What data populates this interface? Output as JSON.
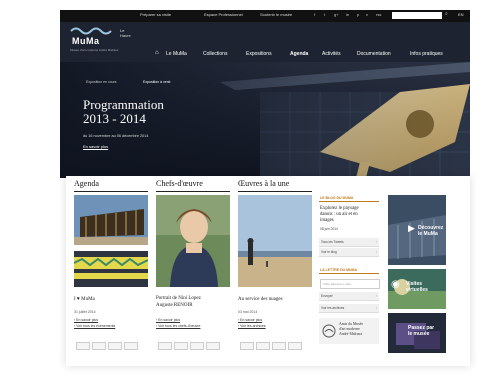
{
  "topbar": {
    "links": [
      "Préparer sa visite",
      "Espace Professionnel",
      "Soutenir le musée"
    ],
    "social": [
      "f",
      "t",
      "g+",
      "in",
      "p",
      "v",
      "rss"
    ],
    "lang": "EN"
  },
  "logo": {
    "name": "MuMa",
    "city": "Le Havre",
    "tagline": "Musée d'art moderne André Malraux"
  },
  "nav": {
    "home_icon": "home-icon",
    "items": [
      "Le MuMa",
      "Collections",
      "Expositions",
      "Agenda",
      "Activités",
      "Documentation",
      "Infos pratiques"
    ],
    "active": "Agenda"
  },
  "subnav": [
    "Exposition en cours",
    "Exposition à venir"
  ],
  "hero": {
    "title_line1": "Programmation",
    "title_line2": "2013 - 2014",
    "dates": "du 16 novembre au 06 décembre 2014",
    "more": "En savoir plus"
  },
  "columns": {
    "agenda": {
      "title": "Agenda",
      "caption": "I ♥ MuMa",
      "date": "31 juillet 2014",
      "links": [
        "› En savoir plus",
        "› Voir tous les événements"
      ]
    },
    "chefs": {
      "title": "Chefs-d'œuvre",
      "caption_line1": "Portrait de Nini Lopez",
      "caption_line2": "Auguste RENOIR",
      "links": [
        "› En savoir plus",
        "› Voir tous les chefs-d'œuvre"
      ]
    },
    "oeuvres": {
      "title": "Œuvres à la une",
      "caption": "Au service des nuages",
      "date": "03 mai 2014",
      "links": [
        "› En savoir plus",
        "› Voir les archives"
      ]
    }
  },
  "sidebar": {
    "blog_head": "LE BLOG DU MUMA",
    "blog_title": [
      "Explorez le paysage",
      "danois : un air et en",
      "images"
    ],
    "blog_date": "08 juin 2014",
    "blog_rows": [
      "Tous les Tweets",
      "Voir le blog"
    ],
    "letter_head": "LA LETTRE DU MUMA",
    "letter_input": "Votre adresse e-mail",
    "letter_rows": [
      "Envoyer",
      "Voir les archives"
    ],
    "friends": [
      "Amis du Musée",
      "d'art moderne",
      "André Malraux"
    ]
  },
  "tiles": [
    "Découvrez",
    "le MuMa",
    "Visites",
    "virtuelles",
    "Passez par",
    "le musée"
  ],
  "colors": {
    "accent": "#c07a1a",
    "dark": "#111111",
    "hero": "#1d2330"
  }
}
